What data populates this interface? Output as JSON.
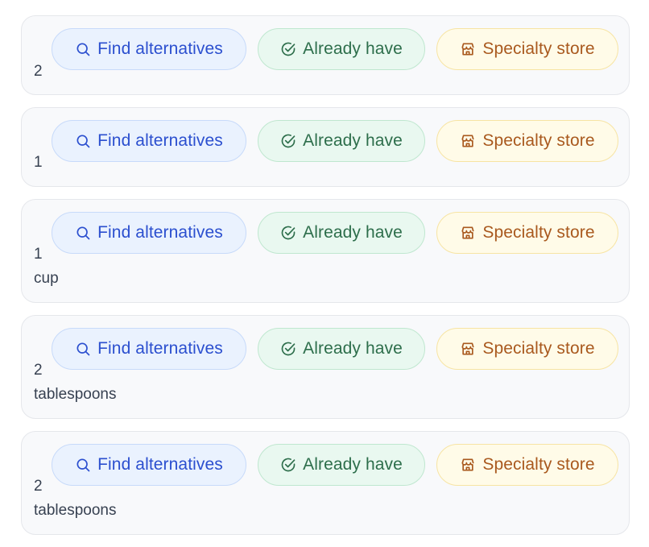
{
  "actions": {
    "find_label": "Find alternatives",
    "have_label": "Already have",
    "store_label": "Specialty store"
  },
  "ingredients": [
    {
      "quantity": "2",
      "unit": ""
    },
    {
      "quantity": "1",
      "unit": ""
    },
    {
      "quantity": "1",
      "unit": "cup"
    },
    {
      "quantity": "2",
      "unit": "tablespoons"
    },
    {
      "quantity": "2",
      "unit": "tablespoons"
    }
  ],
  "icons": {
    "find": "search-icon",
    "have": "check-circle-icon",
    "store": "store-icon"
  },
  "colors": {
    "find_text": "#2b4fcf",
    "have_text": "#2d6e4b",
    "store_text": "#a9591e"
  }
}
